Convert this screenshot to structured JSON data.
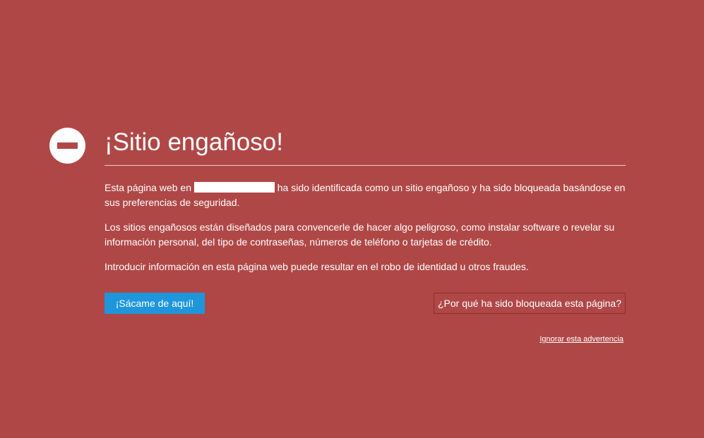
{
  "page": {
    "background_color": "#b04747",
    "icon": "block-icon",
    "title": "¡Sitio engañoso!"
  },
  "content": {
    "p1_prefix": "Esta página web en",
    "p1_suffix": "ha sido identificada como un sitio engañoso y ha sido bloqueada basándose en sus preferencias de seguridad.",
    "p2": "Los sitios engañosos están diseñados para convencerle de hacer algo peligroso, como instalar software o revelar su información personal, del tipo de contraseñas, números de teléfono o tarjetas de crédito.",
    "p3": "Introducir información en esta página web puede resultar en el robo de identidad u otros fraudes."
  },
  "actions": {
    "get_me_out_label": "¡Sácame de aquí!",
    "get_me_out_color": "#1e96dc",
    "why_blocked_label": "¿Por qué ha sido bloqueada esta página?",
    "ignore_label": "Ignorar esta advertencia"
  }
}
